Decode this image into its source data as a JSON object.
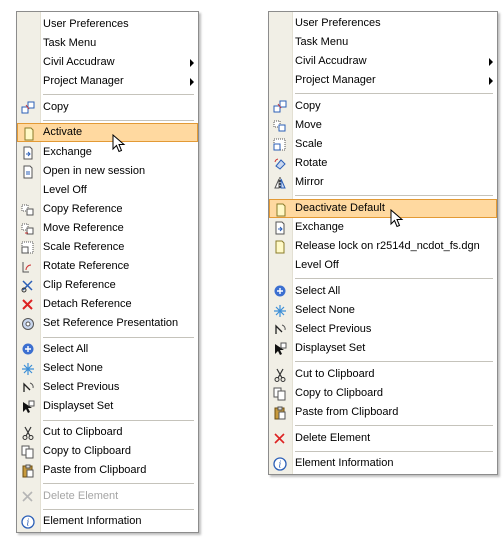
{
  "left_menu": {
    "items": [
      {
        "label": "User Preferences",
        "icon": "none"
      },
      {
        "label": "Task Menu",
        "icon": "none"
      },
      {
        "label": "Civil Accudraw",
        "icon": "none",
        "submenu": true
      },
      {
        "label": "Project Manager",
        "icon": "none",
        "submenu": true
      },
      {
        "label": "Copy",
        "icon": "copy-icon"
      },
      {
        "label": "Activate",
        "icon": "document-icon",
        "highlighted": true
      },
      {
        "label": "Exchange",
        "icon": "exchange-icon"
      },
      {
        "label": "Open in new session",
        "icon": "open-session-icon"
      },
      {
        "label": "Level Off",
        "icon": "none"
      },
      {
        "label": "Copy Reference",
        "icon": "copy-reference-icon"
      },
      {
        "label": "Move Reference",
        "icon": "move-reference-icon"
      },
      {
        "label": "Scale Reference",
        "icon": "scale-reference-icon"
      },
      {
        "label": "Rotate Reference",
        "icon": "rotate-reference-icon"
      },
      {
        "label": "Clip Reference",
        "icon": "clip-reference-icon"
      },
      {
        "label": "Detach Reference",
        "icon": "detach-reference-icon"
      },
      {
        "label": "Set Reference Presentation",
        "icon": "reference-presentation-icon"
      },
      {
        "label": "Select All",
        "icon": "select-all-icon"
      },
      {
        "label": "Select None",
        "icon": "select-none-icon"
      },
      {
        "label": "Select Previous",
        "icon": "select-previous-icon"
      },
      {
        "label": "Displayset Set",
        "icon": "displayset-icon"
      },
      {
        "label": "Cut to Clipboard",
        "icon": "cut-icon"
      },
      {
        "label": "Copy to Clipboard",
        "icon": "copy-clipboard-icon"
      },
      {
        "label": "Paste from Clipboard",
        "icon": "paste-icon"
      },
      {
        "label": "Delete Element",
        "icon": "delete-icon",
        "disabled": true
      },
      {
        "label": "Element Information",
        "icon": "info-icon"
      }
    ]
  },
  "right_menu": {
    "items": [
      {
        "label": "User Preferences",
        "icon": "none"
      },
      {
        "label": "Task Menu",
        "icon": "none"
      },
      {
        "label": "Civil Accudraw",
        "icon": "none",
        "submenu": true
      },
      {
        "label": "Project Manager",
        "icon": "none",
        "submenu": true
      },
      {
        "label": "Copy",
        "icon": "copy-icon"
      },
      {
        "label": "Move",
        "icon": "move-icon"
      },
      {
        "label": "Scale",
        "icon": "scale-icon"
      },
      {
        "label": "Rotate",
        "icon": "rotate-icon"
      },
      {
        "label": "Mirror",
        "icon": "mirror-icon"
      },
      {
        "label": "Deactivate Default",
        "icon": "document-icon",
        "highlighted": true
      },
      {
        "label": "Exchange",
        "icon": "exchange-icon"
      },
      {
        "label": "Release lock on r2514d_ncdot_fs.dgn",
        "icon": "document-icon"
      },
      {
        "label": "Level Off",
        "icon": "none"
      },
      {
        "label": "Select All",
        "icon": "select-all-icon"
      },
      {
        "label": "Select None",
        "icon": "select-none-icon"
      },
      {
        "label": "Select Previous",
        "icon": "select-previous-icon"
      },
      {
        "label": "Displayset Set",
        "icon": "displayset-icon"
      },
      {
        "label": "Cut to Clipboard",
        "icon": "cut-icon"
      },
      {
        "label": "Copy to Clipboard",
        "icon": "copy-clipboard-icon"
      },
      {
        "label": "Paste from Clipboard",
        "icon": "paste-icon"
      },
      {
        "label": "Delete Element",
        "icon": "delete-icon"
      },
      {
        "label": "Element Information",
        "icon": "info-icon"
      }
    ]
  },
  "colors": {
    "highlight_fill": "#ffd9a0",
    "highlight_border": "#e39a35",
    "gutter": "#f1efe6",
    "disabled_text": "#a5a5a5"
  }
}
